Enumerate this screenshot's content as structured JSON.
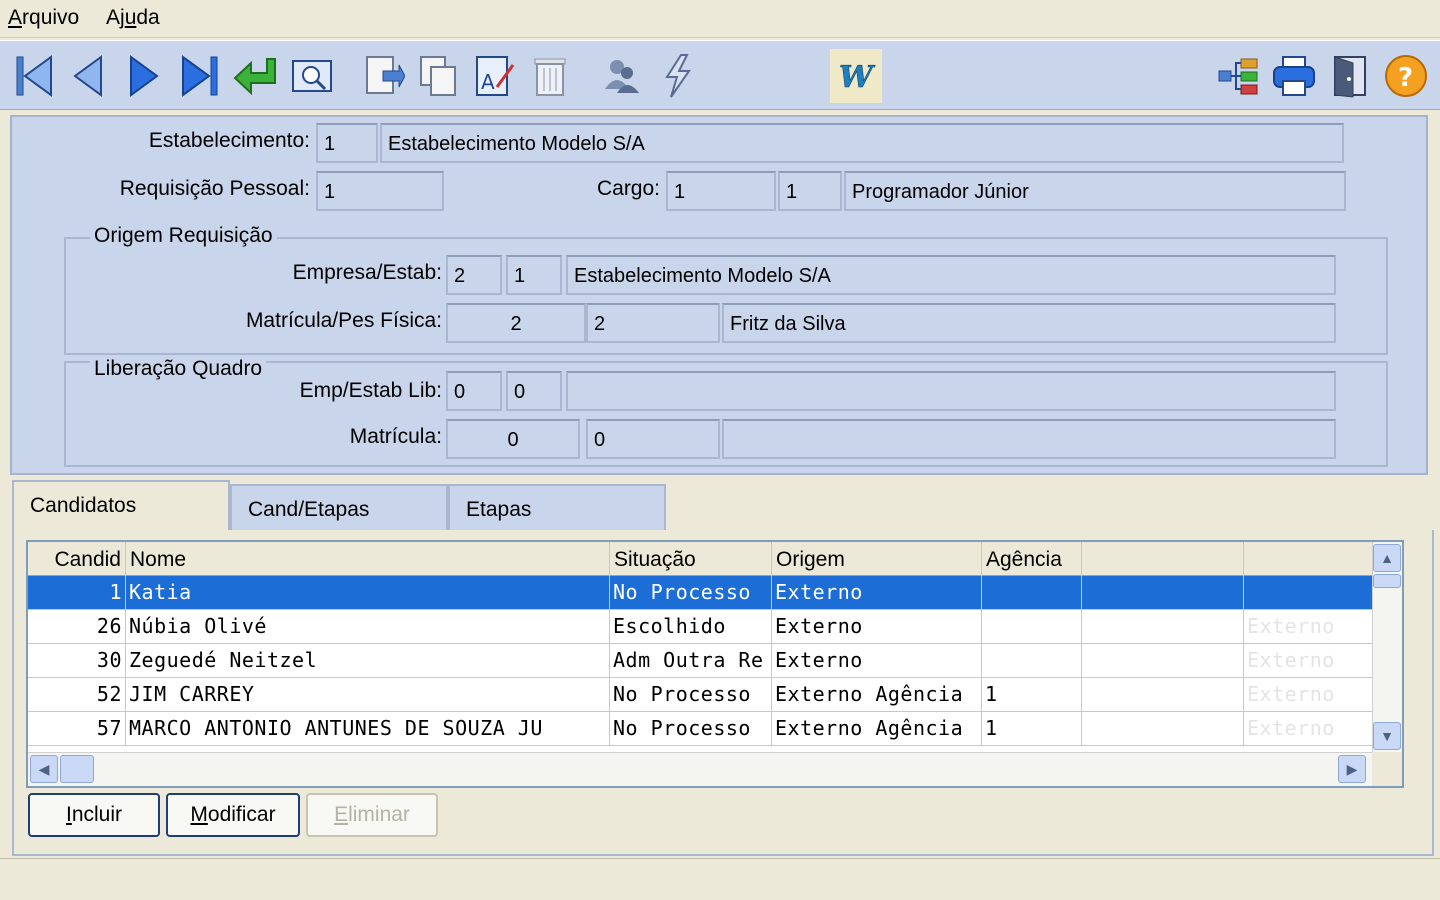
{
  "menu": {
    "file": {
      "underline": "A",
      "rest": "rquivo"
    },
    "help": {
      "pre": "Aj",
      "underline": "u",
      "rest": "da"
    }
  },
  "toolbar": {
    "left_icons": [
      "first-record-icon",
      "previous-record-icon",
      "next-record-icon",
      "last-record-icon",
      "enter-icon",
      "preview-icon",
      "export-icon",
      "copy-icon",
      "edit-text-icon",
      "delete-icon",
      "users-icon",
      "lightning-icon",
      "word-icon"
    ],
    "right_icons": [
      "tree-icon",
      "printer-icon",
      "exit-door-icon",
      "help-icon"
    ]
  },
  "header": {
    "estabelecimento_label": "Estabelecimento:",
    "estabelecimento_code": "1",
    "estabelecimento_name": "Estabelecimento Modelo S/A",
    "requisicao_label": "Requisição Pessoal:",
    "requisicao_value": "1",
    "cargo_label": "Cargo:",
    "cargo_code1": "1",
    "cargo_code2": "1",
    "cargo_name": "Programador Júnior"
  },
  "origem": {
    "title": "Origem Requisição",
    "empresa_label": "Empresa/Estab:",
    "empresa_code": "2",
    "estab_code": "1",
    "empresa_name": "Estabelecimento Modelo S/A",
    "matricula_label": "Matrícula/Pes Física:",
    "matricula": "2",
    "pes_fisica": "2",
    "pessoa_name": "Fritz da Silva"
  },
  "liberacao": {
    "title": "Liberação Quadro",
    "emp_label": "Emp/Estab Lib:",
    "emp_code": "0",
    "estab_code": "0",
    "emp_name": "",
    "matricula_label": "Matrícula:",
    "matricula": "0",
    "pes": "0",
    "name": ""
  },
  "tabs": [
    {
      "label": "Candidatos",
      "active": true
    },
    {
      "label": "Cand/Etapas",
      "active": false
    },
    {
      "label": "Etapas",
      "active": false
    }
  ],
  "grid": {
    "columns": [
      "Candid",
      "Nome",
      "Situação",
      "Origem",
      "Agência"
    ],
    "rows": [
      {
        "id": "1",
        "nome": "Katia",
        "situacao": "No Processo",
        "origem": "Externo",
        "agencia": "",
        "ghost": ""
      },
      {
        "id": "26",
        "nome": "Núbia Olivé",
        "situacao": "Escolhido",
        "origem": "Externo",
        "agencia": "",
        "ghost": "Externo"
      },
      {
        "id": "30",
        "nome": "Zeguedé Neitzel",
        "situacao": "Adm Outra Re",
        "origem": "Externo",
        "agencia": "",
        "ghost": "Externo"
      },
      {
        "id": "52",
        "nome": "JIM CARREY",
        "situacao": "No Processo",
        "origem": "Externo Agência",
        "agencia": "1",
        "ghost": "Externo"
      },
      {
        "id": "57",
        "nome": "MARCO ANTONIO ANTUNES DE SOUZA JU",
        "situacao": "No Processo",
        "origem": "Externo Agência",
        "agencia": "1",
        "ghost": "Externo"
      }
    ],
    "selected_row": 0
  },
  "buttons": {
    "incluir": {
      "underline": "I",
      "rest": "ncluir"
    },
    "modificar": {
      "underline": "M",
      "rest": "odificar"
    },
    "eliminar": {
      "underline": "E",
      "rest": "liminar"
    }
  }
}
